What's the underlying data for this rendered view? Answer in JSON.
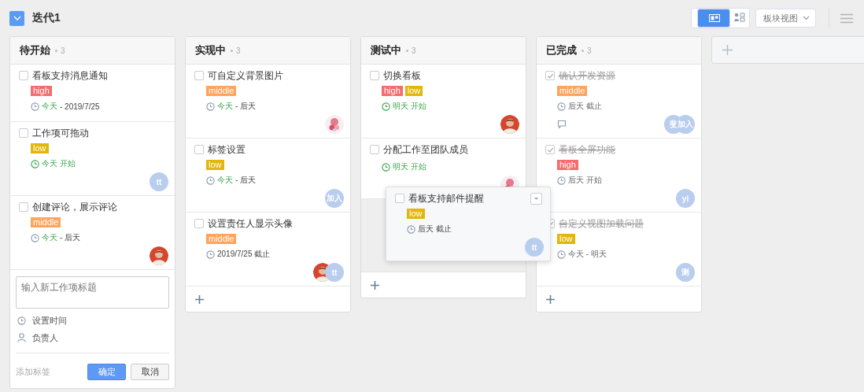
{
  "header": {
    "title": "迭代1"
  },
  "view_toggle": [
    {
      "kind": "board",
      "selected": true
    },
    {
      "kind": "member",
      "selected": false
    }
  ],
  "view_select": {
    "value": "板块视图"
  },
  "columns": [
    {
      "title": "待开始",
      "count": "3",
      "cards": [
        {
          "title": "看板支持消息通知",
          "checked": false,
          "comment": false,
          "tags": [
            {
              "label": "high",
              "color": "#f56c6c"
            }
          ],
          "date": [
            {
              "text": "今天",
              "highlight": true
            },
            {
              "text": "- 2019/7/25",
              "highlight": false
            }
          ]
        },
        {
          "title": "工作项可拖动",
          "checked": false,
          "comment": false,
          "tags": [
            {
              "label": "low",
              "color": "#e2b70c"
            }
          ],
          "date": [
            {
              "text": "今天 开始",
              "highlight": true
            }
          ],
          "avatars": [
            {
              "kind": "initials",
              "text": "tt"
            }
          ]
        },
        {
          "title": "创建评论，展示评论",
          "checked": false,
          "comment": false,
          "tags": [
            {
              "label": "middle",
              "color": "#ffa45c"
            }
          ],
          "date": [
            {
              "text": "今天",
              "highlight": true
            },
            {
              "text": "- 后天",
              "highlight": false
            }
          ],
          "avatars": [
            {
              "kind": "photo"
            }
          ]
        }
      ],
      "new_item_form": {
        "placeholder": "输入新工作项标题",
        "time_label": "设置时间",
        "assignee_label": "负责人",
        "add_tag": "添加标签",
        "confirm": "确定",
        "cancel": "取消"
      },
      "placeholder_slot": false
    },
    {
      "title": "实现中",
      "count": "3",
      "cards": [
        {
          "title": "可自定义背景图片",
          "checked": false,
          "comment": false,
          "tags": [
            {
              "label": "middle",
              "color": "#ffa45c"
            }
          ],
          "date": [
            {
              "text": "今天",
              "highlight": true
            },
            {
              "text": "- 后天",
              "highlight": false
            }
          ],
          "avatars": [
            {
              "kind": "illustration"
            }
          ]
        },
        {
          "title": "标签设置",
          "checked": false,
          "comment": false,
          "tags": [
            {
              "label": "low",
              "color": "#e2b70c"
            }
          ],
          "date": [
            {
              "text": "今天",
              "highlight": true
            },
            {
              "text": "- 后天",
              "highlight": false
            }
          ],
          "avatars": [
            {
              "kind": "initials",
              "text": "加入"
            }
          ]
        },
        {
          "title": "设置责任人显示头像",
          "checked": false,
          "comment": false,
          "tags": [
            {
              "label": "middle",
              "color": "#ffa45c"
            }
          ],
          "date": [
            {
              "text": "2019/7/25 截止",
              "highlight": false
            }
          ],
          "avatars": [
            {
              "kind": "photo"
            },
            {
              "kind": "initials",
              "text": "tt"
            }
          ]
        }
      ],
      "placeholder_slot": false
    },
    {
      "title": "测试中",
      "count": "3",
      "cards": [
        {
          "title": "切换看板",
          "checked": false,
          "comment": false,
          "tags": [
            {
              "label": "high",
              "color": "#f56c6c"
            },
            {
              "label": "low",
              "color": "#e2b70c"
            }
          ],
          "date": [
            {
              "text": "明天 开始",
              "highlight": true
            }
          ],
          "avatars": [
            {
              "kind": "photo"
            }
          ]
        },
        {
          "title": "分配工作至团队成员",
          "checked": false,
          "comment": false,
          "date": [
            {
              "text": "明天 开始",
              "highlight": true
            }
          ],
          "avatars": [
            {
              "kind": "illustration"
            }
          ]
        }
      ],
      "placeholder_slot": true
    },
    {
      "title": "已完成",
      "count": "3",
      "cards": [
        {
          "title": "确认开发资源",
          "checked": true,
          "comment": true,
          "tags": [
            {
              "label": "middle",
              "color": "#ffa45c"
            }
          ],
          "date": [
            {
              "text": "后天 截止",
              "highlight": false
            }
          ],
          "avatars": [
            {
              "kind": "initials",
              "text": "斐"
            },
            {
              "kind": "initials",
              "text": "加入"
            }
          ]
        },
        {
          "title": "看板全屏功能",
          "checked": true,
          "comment": false,
          "tags": [
            {
              "label": "high",
              "color": "#f56c6c"
            }
          ],
          "date": [
            {
              "text": "后天 开始",
              "highlight": false
            }
          ],
          "avatars": [
            {
              "kind": "initials",
              "text": "yi"
            }
          ]
        },
        {
          "title": "自定义视图加载问题",
          "checked": true,
          "comment": false,
          "tags": [
            {
              "label": "low",
              "color": "#e2b70c"
            }
          ],
          "date": [
            {
              "text": "今天 - 明天",
              "highlight": false
            }
          ],
          "avatars": [
            {
              "kind": "initials",
              "text": "测"
            }
          ]
        }
      ],
      "placeholder_slot": false
    }
  ],
  "dragging_card": {
    "title": "看板支持邮件提醒",
    "checked": false,
    "comment": false,
    "tags": [
      {
        "label": "low",
        "color": "#e2b70c"
      }
    ],
    "date": [
      {
        "text": "后天 截止",
        "highlight": false
      }
    ],
    "avatars": [
      {
        "kind": "initials",
        "text": "tt"
      }
    ]
  }
}
